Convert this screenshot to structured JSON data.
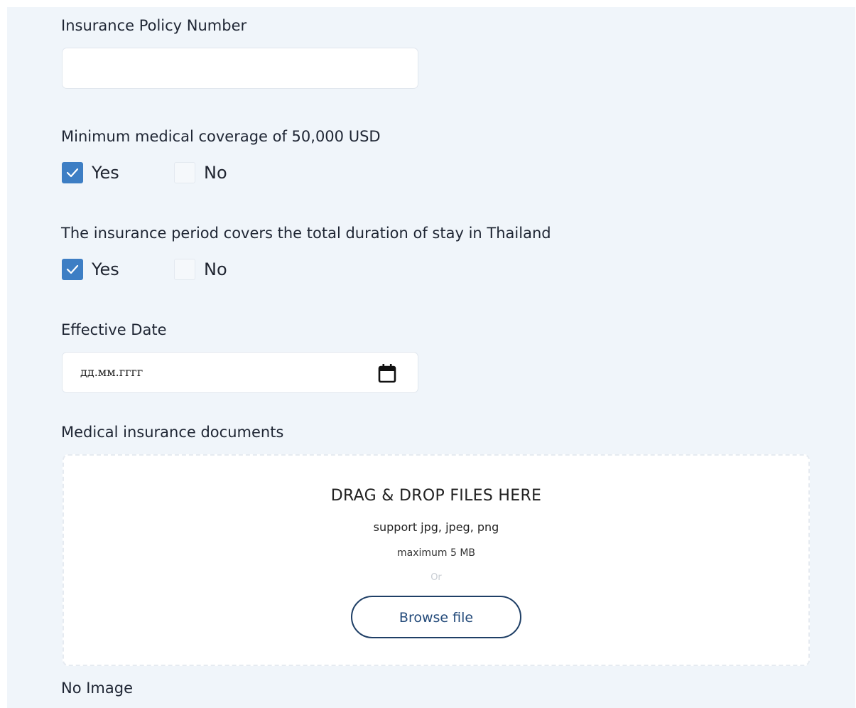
{
  "form": {
    "policy_number": {
      "label": "Insurance Policy Number",
      "value": "",
      "placeholder": ""
    },
    "coverage_question": {
      "label": "Minimum medical coverage of 50,000 USD",
      "options": [
        {
          "label": "Yes",
          "checked": true
        },
        {
          "label": "No",
          "checked": false
        }
      ]
    },
    "period_question": {
      "label": "The insurance period covers the total duration of stay in Thailand",
      "options": [
        {
          "label": "Yes",
          "checked": true
        },
        {
          "label": "No",
          "checked": false
        }
      ]
    },
    "effective_date": {
      "label": "Effective Date",
      "placeholder": "дд.мм.гггг",
      "icon": "calendar-icon"
    },
    "documents": {
      "label": "Medical insurance documents",
      "dropzone_title": "DRAG & DROP FILES HERE",
      "support_text": "support jpg, jpeg, png",
      "max_size_text": "maximum 5 MB",
      "or_text": "Or",
      "browse_label": "Browse file"
    },
    "no_image_text": "No Image"
  },
  "colors": {
    "accent": "#3d7ec4",
    "button_border": "#1f3f66",
    "panel_background": "#f0f5fa"
  }
}
